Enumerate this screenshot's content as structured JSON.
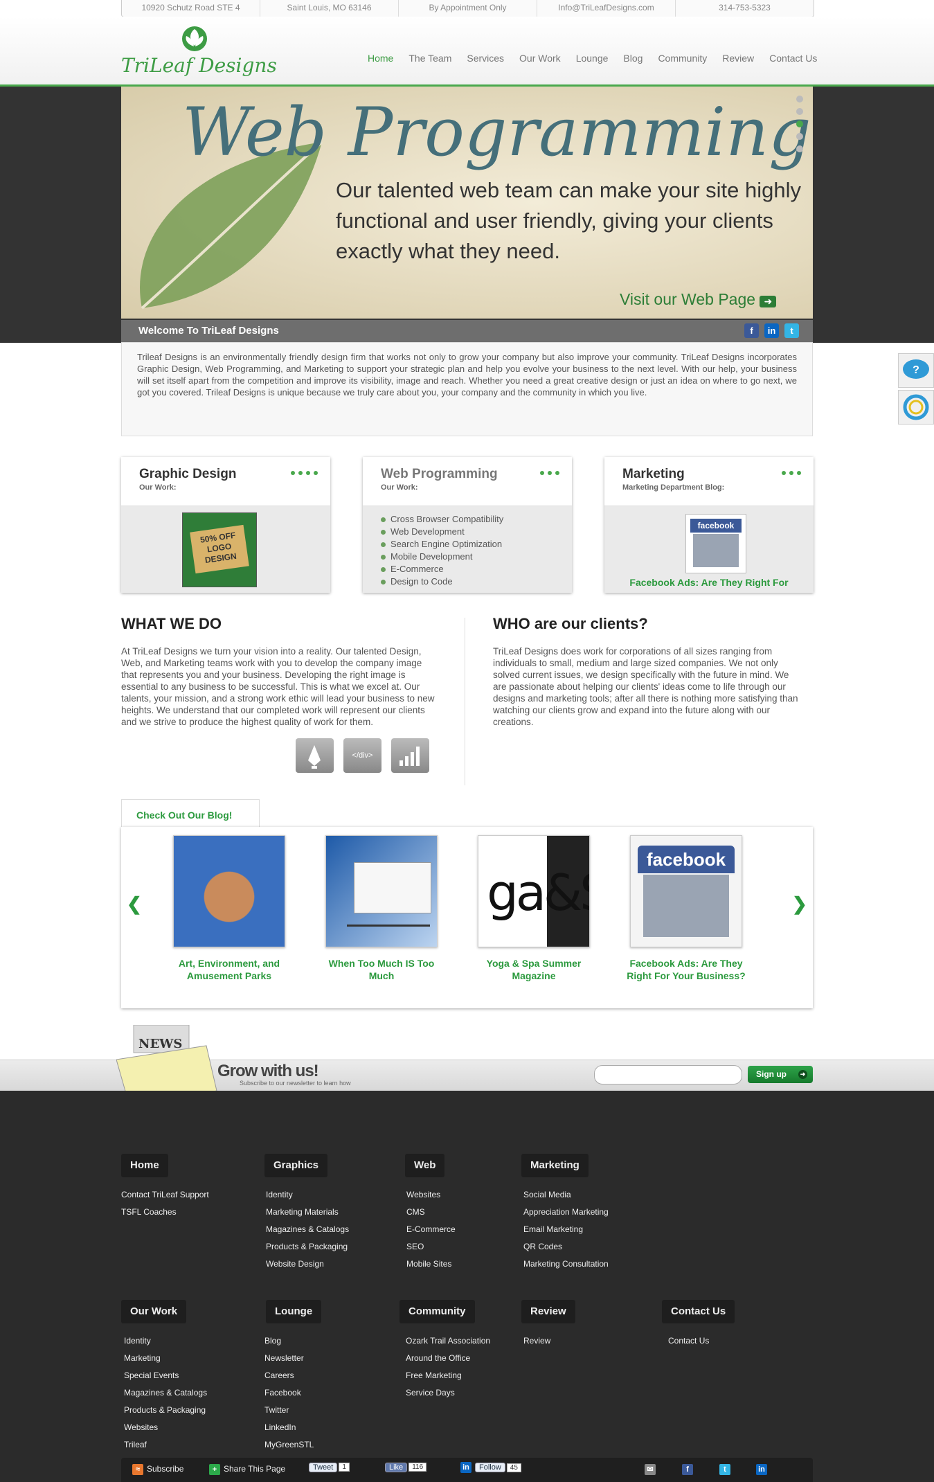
{
  "topbar": {
    "address": "10920 Schutz Road STE 4",
    "city": "Saint Louis, MO 63146",
    "hours": "By Appointment Only",
    "email": "Info@TriLeafDesigns.com",
    "phone": "314-753-5323"
  },
  "brand": {
    "logo_text": "TriLeaf Designs",
    "accent": "#49a84c"
  },
  "nav": [
    "Home",
    "The Team",
    "Services",
    "Our Work",
    "Lounge",
    "Blog",
    "Community",
    "Review",
    "Contact Us"
  ],
  "hero": {
    "title": "Web Programming",
    "description": "Our talented web team can make your site highly functional and user friendly, giving your clients exactly what they need.",
    "cta": "Visit our Web Page",
    "slide_count": 5,
    "active_slide": 3
  },
  "welcome": {
    "title": "Welcome To TriLeaf Designs",
    "body": "Trileaf Designs is an environmentally friendly design firm that works not only to grow your company but also improve your community. TriLeaf Designs incorporates Graphic Design, Web Programming, and Marketing to support your strategic plan and help you evolve your business to the next level. With our help, your business will set itself apart from the competition and improve its visibility, image and reach. Whether you need a great creative design or just an idea on where to go next, we got you covered. Trileaf Designs is unique because we truly care about you, your company and the community in which you live.",
    "social": [
      "facebook-icon",
      "linkedin-icon",
      "twitter-icon"
    ]
  },
  "services": [
    {
      "title": "Graphic Design",
      "subtitle": "Our Work:",
      "image_text": "50% OFF LOGO DESIGN"
    },
    {
      "title": "Web Programming",
      "subtitle": "Our Work:",
      "items": [
        "Cross Browser Compatibility",
        "Web Development",
        "Search Engine Optimization",
        "Mobile Development",
        "E-Commerce",
        "Design to Code"
      ]
    },
    {
      "title": "Marketing",
      "subtitle": "Marketing Department Blog:",
      "image_text": "facebook",
      "link": "Facebook Ads: Are They Right For"
    }
  ],
  "whatwedo": {
    "title": "WHAT WE DO",
    "body": "At TriLeaf Designs we turn your vision into a reality. Our talented Design, Web, and Marketing teams work with you to develop the company image that represents you and your business. Developing the right image is essential to any business to be successful. This is what we excel at. Our talents, your mission, and a strong work ethic will lead your business to new heights. We understand that our completed work will represent our clients and we strive to produce the highest quality of work for them.",
    "icon_code_text": "</div>"
  },
  "clients": {
    "title": "WHO are our clients?",
    "body": "TriLeaf Designs does work for corporations of all sizes ranging from individuals to small, medium and large sized companies. We not only solved current issues, we design specifically with the future in mind. We are passionate about helping our clients' ideas come to life through our designs and marketing tools; after all there is nothing more satisfying than watching our clients grow and expand into the future along with our creations."
  },
  "blog": {
    "tab": "Check Out Our Blog!",
    "posts": [
      {
        "title": "Art, Environment, and Amusement Parks"
      },
      {
        "title": "When Too Much IS Too Much"
      },
      {
        "title": "Yoga & Spa Summer Magazine",
        "thumb_text": "ga&S"
      },
      {
        "title": "Facebook Ads: Are They Right For Your Business?",
        "thumb_text": "facebook"
      }
    ]
  },
  "newsletter": {
    "badge": "NEWS",
    "title": "Grow with us!",
    "subtitle": "Subscribe to our newsletter to learn how",
    "button": "Sign up",
    "placeholder": ""
  },
  "footer": {
    "columns_row1": [
      {
        "heading": "Home",
        "links": [
          "Contact TriLeaf Support",
          "TSFL Coaches"
        ]
      },
      {
        "heading": "Graphics",
        "links": [
          "Identity",
          "Marketing Materials",
          "Magazines & Catalogs",
          "Products & Packaging",
          "Website Design"
        ]
      },
      {
        "heading": "Web",
        "links": [
          "Websites",
          "CMS",
          "E-Commerce",
          "SEO",
          "Mobile Sites"
        ]
      },
      {
        "heading": "Marketing",
        "links": [
          "Social Media",
          "Appreciation Marketing",
          "Email Marketing",
          "QR Codes",
          "Marketing Consultation"
        ]
      }
    ],
    "columns_row2": [
      {
        "heading": "Our Work",
        "links": [
          "Identity",
          "Marketing",
          "Special Events",
          "Magazines & Catalogs",
          "Products & Packaging",
          "Websites",
          "Trileaf"
        ]
      },
      {
        "heading": "Lounge",
        "links": [
          "Blog",
          "Newsletter",
          "Careers",
          "Facebook",
          "Twitter",
          "LinkedIn",
          "MyGreenSTL"
        ]
      },
      {
        "heading": "Community",
        "links": [
          "Ozark Trail Association",
          "Around the Office",
          "Free Marketing",
          "Service Days"
        ]
      },
      {
        "heading": "Review",
        "links": [
          "Review"
        ]
      },
      {
        "heading": "Contact Us",
        "links": [
          "Contact Us"
        ]
      }
    ],
    "share": {
      "subscribe": "Subscribe",
      "share_page": "Share This Page",
      "tweet": "Tweet",
      "tweet_count": "1",
      "like": "Like",
      "like_count": "116",
      "follow": "Follow",
      "follow_count": "45"
    }
  }
}
